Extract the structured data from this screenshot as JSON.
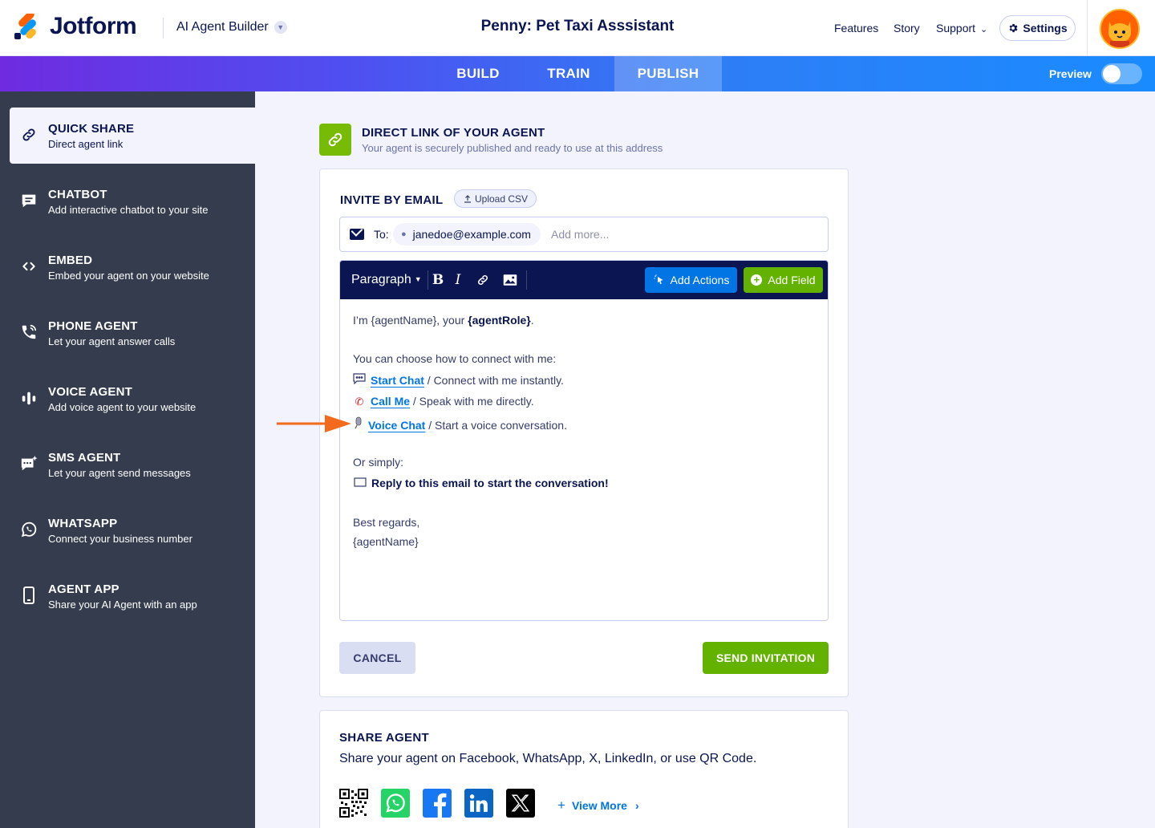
{
  "header": {
    "brand": "Jotform",
    "product": "AI Agent Builder",
    "agent_title": "Penny: Pet Taxi Asssistant",
    "nav": {
      "features": "Features",
      "story": "Story",
      "support": "Support"
    },
    "settings_label": "Settings",
    "support_chevron": "⌄"
  },
  "tabs": {
    "build": "BUILD",
    "train": "TRAIN",
    "publish": "PUBLISH",
    "active": "PUBLISH"
  },
  "preview": {
    "label": "Preview",
    "enabled": false
  },
  "sidebar": {
    "items": [
      {
        "title": "QUICK SHARE",
        "subtitle": "Direct agent link",
        "icon": "link-icon",
        "active": true
      },
      {
        "title": "CHATBOT",
        "subtitle": "Add interactive chatbot to your site",
        "icon": "chat-bubble-icon"
      },
      {
        "title": "EMBED",
        "subtitle": "Embed your agent on your website",
        "icon": "code-icon"
      },
      {
        "title": "PHONE AGENT",
        "subtitle": "Let your agent answer calls",
        "icon": "phone-icon"
      },
      {
        "title": "VOICE AGENT",
        "subtitle": "Add voice agent to your website",
        "icon": "voice-bars-icon"
      },
      {
        "title": "SMS AGENT",
        "subtitle": "Let your agent send messages",
        "icon": "sms-icon"
      },
      {
        "title": "WHATSAPP",
        "subtitle": "Connect your business number",
        "icon": "whatsapp-icon"
      },
      {
        "title": "AGENT APP",
        "subtitle": "Share your AI Agent with an app",
        "icon": "mobile-icon"
      }
    ]
  },
  "section": {
    "title": "DIRECT LINK OF YOUR AGENT",
    "subtitle": "Your agent is securely published and ready to use at this address"
  },
  "invite": {
    "title": "INVITE BY EMAIL",
    "upload_csv": "Upload CSV",
    "to_label": "To:",
    "recipient": "janedoe@example.com",
    "add_more_placeholder": "Add more...",
    "toolbar": {
      "paragraph": "Paragraph",
      "bold": "B",
      "italic": "I",
      "add_actions": "Add Actions",
      "add_field": "Add Field"
    },
    "body": {
      "intro_prefix": "I’m {agentName}, your ",
      "intro_role": "{agentRole}",
      "intro_suffix": ".",
      "choose": "You can choose how to connect with me:",
      "start_chat_link": "Start Chat",
      "start_chat_text": " / Connect with me instantly.",
      "call_me_link": "Call Me",
      "call_me_text": " / Speak with me directly.",
      "voice_chat_link": "Voice Chat",
      "voice_chat_text": " / Start a voice conversation.",
      "or_simply": "Or simply:",
      "reply": "Reply to this email to start the conversation!",
      "regards": "Best regards,",
      "signature": "{agentName}"
    },
    "cancel": "CANCEL",
    "send": "SEND INVITATION"
  },
  "share": {
    "title": "SHARE AGENT",
    "subtitle": "Share your agent on Facebook, WhatsApp, X, LinkedIn, or use QR Code.",
    "view_more": "View More"
  },
  "colors": {
    "navy": "#0a1551",
    "sidebar_bg": "#343c4d",
    "accent_blue": "#0075e3",
    "green": "#64b200",
    "annotation_arrow": "#f26a1b"
  }
}
